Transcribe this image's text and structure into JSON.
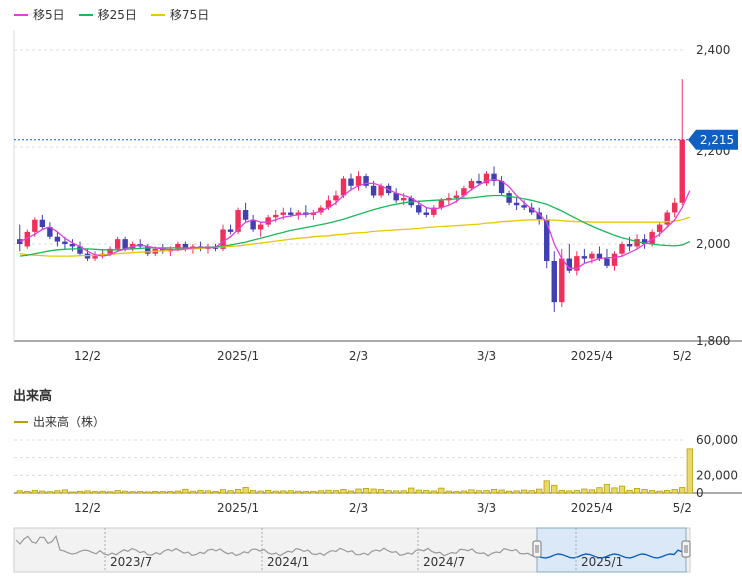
{
  "legend": [
    {
      "label": "移5日",
      "color": "#e040e0"
    },
    {
      "label": "移25日",
      "color": "#19b85a"
    },
    {
      "label": "移75日",
      "color": "#e8c800"
    }
  ],
  "volume_section": {
    "title": "出来高",
    "legend_label": "出来高（株）",
    "color": "#b8a000"
  },
  "price_badge": "2,215",
  "colors": {
    "up": "#f0305a",
    "down": "#4040b0",
    "badge": "#1060c0"
  },
  "navigator_labels": [
    "2023/7",
    "2024/1",
    "2024/7",
    "2025/1"
  ],
  "chart_data": [
    {
      "type": "candlestick",
      "x_tick_labels": [
        "12/2",
        "2025/1",
        "2/3",
        "3/3",
        "2025/4",
        "5/2"
      ],
      "y_tick_labels": [
        "2,400",
        "2,000",
        "1,800"
      ],
      "ylim": [
        1800,
        2400
      ],
      "last_price": 2215,
      "candles": [
        [
          2010,
          2040,
          1985,
          2000
        ],
        [
          1995,
          2030,
          1990,
          2025
        ],
        [
          2025,
          2055,
          2015,
          2050
        ],
        [
          2050,
          2060,
          2030,
          2035
        ],
        [
          2035,
          2045,
          2010,
          2015
        ],
        [
          2015,
          2025,
          1995,
          2005
        ],
        [
          2005,
          2015,
          1990,
          2000
        ],
        [
          2000,
          2010,
          1985,
          1995
        ],
        [
          1995,
          2005,
          1975,
          1980
        ],
        [
          1980,
          1990,
          1965,
          1970
        ],
        [
          1970,
          1985,
          1965,
          1975
        ],
        [
          1975,
          1990,
          1970,
          1980
        ],
        [
          1980,
          1995,
          1975,
          1990
        ],
        [
          1990,
          2015,
          1985,
          2010
        ],
        [
          2010,
          2015,
          1985,
          1990
        ],
        [
          1990,
          2005,
          1985,
          2000
        ],
        [
          2000,
          2010,
          1990,
          1995
        ],
        [
          1995,
          2000,
          1975,
          1980
        ],
        [
          1980,
          1995,
          1975,
          1990
        ],
        [
          1990,
          2000,
          1980,
          1985
        ],
        [
          1985,
          1995,
          1975,
          1990
        ],
        [
          1990,
          2005,
          1985,
          2000
        ],
        [
          2000,
          2005,
          1985,
          1990
        ],
        [
          1990,
          2000,
          1980,
          1995
        ],
        [
          1995,
          2005,
          1985,
          1990
        ],
        [
          1990,
          2000,
          1980,
          1995
        ],
        [
          1995,
          2000,
          1985,
          1990
        ],
        [
          1990,
          2040,
          1985,
          2030
        ],
        [
          2030,
          2040,
          2020,
          2025
        ],
        [
          2025,
          2075,
          2020,
          2070
        ],
        [
          2070,
          2085,
          2045,
          2050
        ],
        [
          2050,
          2060,
          2025,
          2030
        ],
        [
          2030,
          2045,
          2015,
          2040
        ],
        [
          2040,
          2060,
          2035,
          2055
        ],
        [
          2055,
          2070,
          2045,
          2060
        ],
        [
          2060,
          2075,
          2050,
          2065
        ],
        [
          2065,
          2075,
          2055,
          2060
        ],
        [
          2060,
          2070,
          2050,
          2065
        ],
        [
          2065,
          2080,
          2055,
          2060
        ],
        [
          2060,
          2070,
          2050,
          2065
        ],
        [
          2065,
          2080,
          2060,
          2075
        ],
        [
          2075,
          2100,
          2070,
          2090
        ],
        [
          2090,
          2110,
          2080,
          2100
        ],
        [
          2100,
          2140,
          2095,
          2135
        ],
        [
          2135,
          2145,
          2110,
          2120
        ],
        [
          2120,
          2150,
          2110,
          2140
        ],
        [
          2140,
          2145,
          2115,
          2120
        ],
        [
          2120,
          2130,
          2095,
          2100
        ],
        [
          2100,
          2125,
          2095,
          2120
        ],
        [
          2120,
          2125,
          2100,
          2105
        ],
        [
          2105,
          2115,
          2085,
          2090
        ],
        [
          2090,
          2105,
          2080,
          2095
        ],
        [
          2095,
          2100,
          2075,
          2080
        ],
        [
          2080,
          2090,
          2060,
          2065
        ],
        [
          2065,
          2075,
          2055,
          2060
        ],
        [
          2060,
          2080,
          2055,
          2075
        ],
        [
          2075,
          2095,
          2070,
          2090
        ],
        [
          2090,
          2105,
          2080,
          2095
        ],
        [
          2095,
          2110,
          2085,
          2100
        ],
        [
          2100,
          2120,
          2095,
          2115
        ],
        [
          2115,
          2135,
          2110,
          2130
        ],
        [
          2130,
          2145,
          2120,
          2125
        ],
        [
          2125,
          2150,
          2120,
          2145
        ],
        [
          2145,
          2160,
          2120,
          2130
        ],
        [
          2130,
          2140,
          2100,
          2105
        ],
        [
          2105,
          2110,
          2080,
          2085
        ],
        [
          2085,
          2095,
          2070,
          2080
        ],
        [
          2080,
          2090,
          2070,
          2075
        ],
        [
          2075,
          2085,
          2060,
          2065
        ],
        [
          2065,
          2075,
          2040,
          2050
        ],
        [
          2050,
          2060,
          1950,
          1965
        ],
        [
          1965,
          1985,
          1860,
          1880
        ],
        [
          1880,
          1990,
          1870,
          1970
        ],
        [
          1970,
          2000,
          1940,
          1945
        ],
        [
          1945,
          1985,
          1935,
          1975
        ],
        [
          1975,
          1990,
          1960,
          1970
        ],
        [
          1970,
          1985,
          1960,
          1980
        ],
        [
          1980,
          1995,
          1965,
          1970
        ],
        [
          1970,
          1990,
          1950,
          1955
        ],
        [
          1955,
          1985,
          1945,
          1980
        ],
        [
          1980,
          2005,
          1975,
          2000
        ],
        [
          2000,
          2015,
          1985,
          1995
        ],
        [
          1995,
          2020,
          1990,
          2010
        ],
        [
          2010,
          2020,
          1990,
          2000
        ],
        [
          2000,
          2030,
          1995,
          2025
        ],
        [
          2025,
          2045,
          2015,
          2040
        ],
        [
          2040,
          2070,
          2035,
          2065
        ],
        [
          2065,
          2095,
          2055,
          2085
        ],
        [
          2085,
          2340,
          2080,
          2215
        ]
      ],
      "ma5": [
        2005,
        2012,
        2020,
        2030,
        2035,
        2025,
        2012,
        2002,
        1995,
        1985,
        1978,
        1975,
        1978,
        1985,
        1990,
        1995,
        1998,
        1995,
        1992,
        1990,
        1988,
        1988,
        1990,
        1992,
        1993,
        1992,
        1993,
        2005,
        2015,
        2030,
        2045,
        2050,
        2045,
        2045,
        2050,
        2055,
        2058,
        2060,
        2062,
        2063,
        2068,
        2075,
        2085,
        2100,
        2112,
        2120,
        2125,
        2125,
        2120,
        2112,
        2105,
        2100,
        2095,
        2085,
        2075,
        2072,
        2075,
        2080,
        2088,
        2100,
        2112,
        2122,
        2130,
        2133,
        2130,
        2118,
        2100,
        2085,
        2072,
        2062,
        2045,
        2000,
        1970,
        1950,
        1950,
        1960,
        1965,
        1970,
        1972,
        1972,
        1975,
        1982,
        1990,
        2000,
        2010,
        2020,
        2035,
        2050,
        2075,
        2110
      ],
      "ma25": [
        1975,
        1977,
        1980,
        1983,
        1986,
        1988,
        1989,
        1990,
        1990,
        1990,
        1989,
        1988,
        1988,
        1988,
        1989,
        1990,
        1991,
        1992,
        1992,
        1992,
        1992,
        1992,
        1992,
        1992,
        1993,
        1993,
        1994,
        1996,
        1998,
        2001,
        2004,
        2008,
        2012,
        2016,
        2020,
        2024,
        2028,
        2031,
        2034,
        2037,
        2040,
        2043,
        2047,
        2051,
        2056,
        2061,
        2066,
        2071,
        2075,
        2079,
        2082,
        2085,
        2087,
        2088,
        2089,
        2090,
        2091,
        2092,
        2093,
        2094,
        2095,
        2097,
        2099,
        2100,
        2100,
        2098,
        2096,
        2093,
        2090,
        2086,
        2082,
        2075,
        2068,
        2060,
        2052,
        2044,
        2037,
        2030,
        2024,
        2018,
        2013,
        2009,
        2005,
        2002,
        2000,
        1998,
        1997,
        1996,
        1998,
        2005
      ],
      "ma75": [
        1980,
        1978,
        1977,
        1976,
        1975,
        1975,
        1975,
        1975,
        1976,
        1976,
        1977,
        1978,
        1979,
        1980,
        1981,
        1982,
        1983,
        1984,
        1985,
        1986,
        1987,
        1988,
        1989,
        1990,
        1991,
        1992,
        1993,
        1994,
        1995,
        1996,
        1998,
        2000,
        2002,
        2004,
        2006,
        2008,
        2010,
        2012,
        2013,
        2015,
        2016,
        2017,
        2019,
        2020,
        2022,
        2023,
        2024,
        2026,
        2027,
        2028,
        2029,
        2030,
        2031,
        2032,
        2034,
        2035,
        2036,
        2037,
        2038,
        2039,
        2040,
        2041,
        2043,
        2044,
        2046,
        2047,
        2048,
        2049,
        2050,
        2050,
        2050,
        2049,
        2048,
        2047,
        2046,
        2046,
        2045,
        2045,
        2045,
        2045,
        2045,
        2045,
        2045,
        2045,
        2045,
        2045,
        2046,
        2047,
        2050,
        2055
      ]
    },
    {
      "type": "bar",
      "y_tick_labels": [
        "60,000",
        "20,000",
        "0"
      ],
      "ylim": [
        0,
        60000
      ],
      "x_tick_labels": [
        "12/2",
        "2025/1",
        "2/3",
        "3/3",
        "2025/4",
        "5/2"
      ],
      "values": [
        2500,
        1800,
        3000,
        2200,
        1500,
        2600,
        3500,
        1200,
        1900,
        2400,
        1600,
        2000,
        1400,
        2800,
        2100,
        1500,
        1700,
        1300,
        1800,
        1600,
        1700,
        2200,
        4200,
        2000,
        3000,
        2500,
        1800,
        3800,
        2600,
        4100,
        6300,
        2800,
        2200,
        3000,
        2100,
        2400,
        2600,
        2000,
        1700,
        1900,
        2500,
        3100,
        2800,
        4000,
        2300,
        4500,
        5200,
        4500,
        3900,
        2600,
        2400,
        2500,
        5600,
        3200,
        2900,
        2300,
        5500,
        2100,
        1700,
        2200,
        3600,
        2600,
        2800,
        4100,
        3300,
        2100,
        2400,
        3300,
        2700,
        4400,
        13800,
        8700,
        3000,
        2400,
        2800,
        4500,
        3600,
        6000,
        9600,
        5800,
        7800,
        3000,
        5200,
        3900,
        2800,
        2100,
        2900,
        4000,
        6200,
        50000
      ]
    }
  ]
}
